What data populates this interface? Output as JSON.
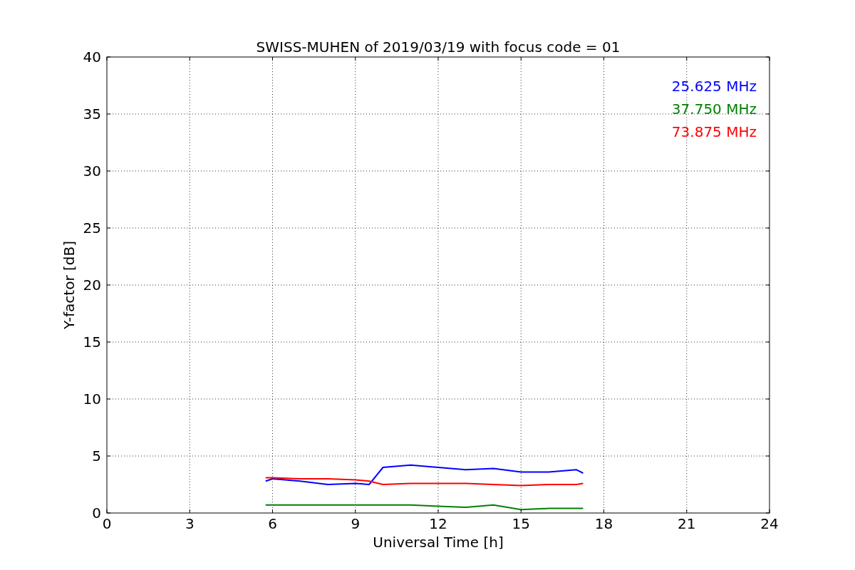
{
  "chart_data": {
    "type": "line",
    "title": "SWISS-MUHEN of 2019/03/19 with focus code = 01",
    "xlabel": "Universal Time [h]",
    "ylabel": "Y-factor [dB]",
    "x": [
      5.75,
      6,
      7,
      8,
      9,
      9.5,
      10,
      11,
      12,
      13,
      14,
      15,
      16,
      17,
      17.25
    ],
    "series": [
      {
        "name": "25.625 MHz",
        "color": "#0000ff",
        "values": [
          2.8,
          3.0,
          2.8,
          2.5,
          2.6,
          2.5,
          4.0,
          4.2,
          4.0,
          3.8,
          3.9,
          3.6,
          3.6,
          3.8,
          3.5
        ]
      },
      {
        "name": "37.750 MHz",
        "color": "#008000",
        "values": [
          0.7,
          0.7,
          0.7,
          0.7,
          0.7,
          0.7,
          0.7,
          0.7,
          0.6,
          0.5,
          0.7,
          0.3,
          0.4,
          0.4,
          0.4
        ]
      },
      {
        "name": "73.875 MHz",
        "color": "#ff0000",
        "values": [
          3.1,
          3.1,
          3.0,
          3.0,
          2.9,
          2.8,
          2.5,
          2.6,
          2.6,
          2.6,
          2.5,
          2.4,
          2.5,
          2.5,
          2.6
        ]
      }
    ],
    "xlim": [
      0,
      24
    ],
    "ylim": [
      0,
      40
    ],
    "xticks": [
      0,
      3,
      6,
      9,
      12,
      15,
      18,
      21,
      24
    ],
    "yticks": [
      0,
      5,
      10,
      15,
      20,
      25,
      30,
      35,
      40
    ],
    "grid": true
  }
}
